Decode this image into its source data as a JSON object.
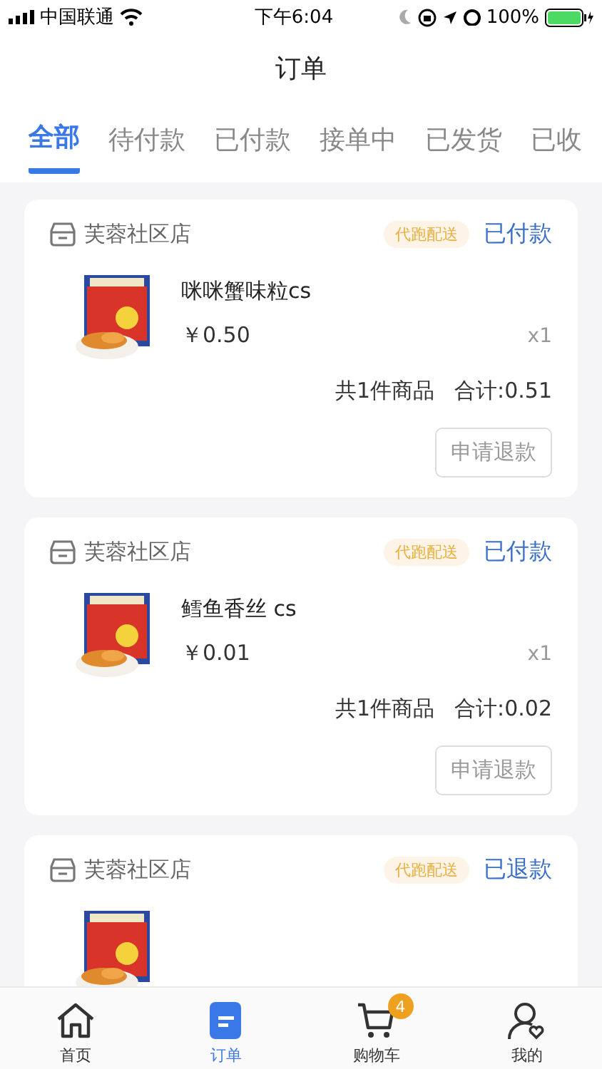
{
  "status_bar": {
    "carrier": "中国联通",
    "time": "下午6:04",
    "battery": "100%"
  },
  "title": "订单",
  "tabs": [
    {
      "label": "全部",
      "selected": true
    },
    {
      "label": "待付款",
      "selected": false
    },
    {
      "label": "已付款",
      "selected": false
    },
    {
      "label": "接单中",
      "selected": false
    },
    {
      "label": "已发货",
      "selected": false
    },
    {
      "label": "已收",
      "selected": false
    }
  ],
  "orders": [
    {
      "store": "芙蓉社区店",
      "tag": "代跑配送",
      "status": "已付款",
      "items": [
        {
          "kind": "product",
          "name": "咪咪蟹味粒cs",
          "price": "￥0.50",
          "qty": "x1"
        }
      ],
      "summary": "共1件商品",
      "total": "合计:0.51",
      "action": "申请退款"
    },
    {
      "store": "芙蓉社区店",
      "tag": "代跑配送",
      "status": "已付款",
      "items": [
        {
          "kind": "product",
          "name": "鳕鱼香丝 cs",
          "price": "￥0.01",
          "qty": "x1"
        }
      ],
      "summary": "共1件商品",
      "total": "合计:0.02",
      "action": "申请退款"
    },
    {
      "store": "芙蓉社区店",
      "tag": "代跑配送",
      "status": "已退款"
    }
  ],
  "tab_bar": [
    {
      "kind": "home",
      "label": "首页",
      "selected": false
    },
    {
      "kind": "orders",
      "label": "订单",
      "selected": true
    },
    {
      "kind": "cart",
      "label": "购物车",
      "selected": false,
      "badge": "4"
    },
    {
      "kind": "profile",
      "label": "我的",
      "selected": false
    }
  ]
}
